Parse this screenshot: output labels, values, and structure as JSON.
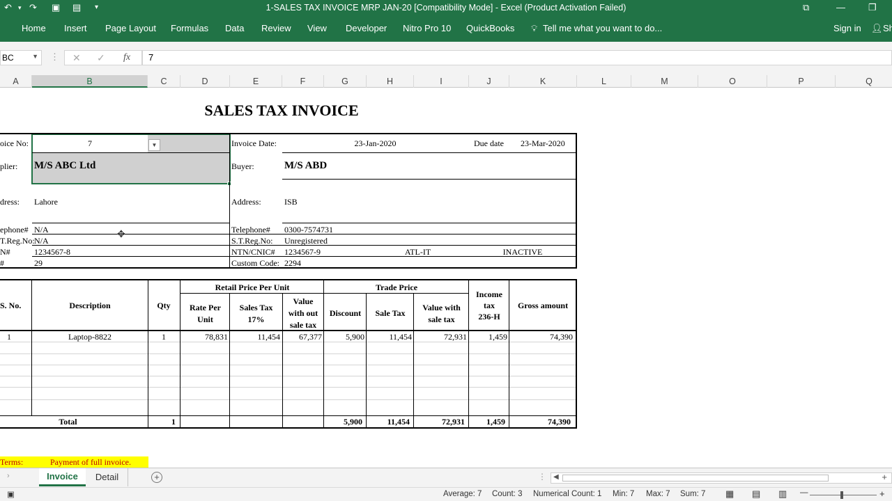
{
  "window": {
    "title": "1-SALES TAX INVOICE MRP JAN-20  [Compatibility Mode] - Excel (Product Activation Failed)"
  },
  "ribbon": {
    "tabs": [
      "Home",
      "Insert",
      "Page Layout",
      "Formulas",
      "Data",
      "Review",
      "View",
      "Developer",
      "Nitro Pro 10",
      "QuickBooks"
    ],
    "tell_me": "Tell me what you want to do...",
    "sign_in": "Sign in",
    "share": "Sh"
  },
  "formula_bar": {
    "name_box": "BC",
    "fx": "fx",
    "value": "7"
  },
  "columns": [
    "A",
    "B",
    "C",
    "D",
    "E",
    "F",
    "G",
    "H",
    "I",
    "J",
    "K",
    "L",
    "M",
    "O",
    "P",
    "Q"
  ],
  "invoice": {
    "heading": "SALES TAX INVOICE",
    "invoice_no_label": "oice No:",
    "invoice_no": "7",
    "invoice_date_label": "Invoice Date:",
    "invoice_date": "23-Jan-2020",
    "due_date_label": "Due date",
    "due_date": "23-Mar-2020",
    "supplier_label": "plier:",
    "supplier": "M/S ABC Ltd",
    "buyer_label": "Buyer:",
    "buyer": "M/S ABD",
    "address_label": "dress:",
    "address": "Lahore",
    "buyer_address_label": "Address:",
    "buyer_address": "ISB",
    "tel_label": "ephone#",
    "tel": "N/A",
    "buyer_tel_label": "Telephone#",
    "buyer_tel": "0300-7574731",
    "streg_label": "T.Reg.No:",
    "streg": "N/A",
    "buyer_streg_label": "S.T.Reg.No:",
    "buyer_streg": "Unregistered",
    "ntn_label": "N#",
    "ntn": "1234567-8",
    "buyer_ntn_label": "NTN/CNIC#",
    "buyer_ntn": "1234567-9",
    "atl": "ATL-IT",
    "status": "INACTIVE",
    "code_label": "#",
    "code": "29",
    "buyer_code_label": "Custom Code:",
    "buyer_code": "2294"
  },
  "table": {
    "h_sno": "S. No.",
    "h_desc": "Description",
    "h_qty": "Qty",
    "h_retail": "Retail Price Per Unit",
    "h_trade": "Trade Price",
    "h_rate1": "Rate Per",
    "h_rate2": "Unit",
    "h_stax1": "Sales Tax",
    "h_stax2": "17%",
    "h_vwo1": "Value",
    "h_vwo2": "with out",
    "h_vwo3": "sale tax",
    "h_disc": "Discount",
    "h_saletax": "Sale Tax",
    "h_vw1": "Value with",
    "h_vw2": "sale tax",
    "h_inc1": "Income",
    "h_inc2": "tax",
    "h_inc3": "236-H",
    "h_gross": "Gross amount",
    "row": {
      "sno": "1",
      "desc": "Laptop-8822",
      "qty": "1",
      "rate": "78,831",
      "stax": "11,454",
      "vwo": "67,377",
      "disc": "5,900",
      "saletax": "11,454",
      "vw": "72,931",
      "inc": "1,459",
      "gross": "74,390"
    },
    "total": {
      "label": "Total",
      "qty": "1",
      "disc": "5,900",
      "saletax": "11,454",
      "vw": "72,931",
      "inc": "1,459",
      "gross": "74,390"
    }
  },
  "terms": {
    "label": "Terms:",
    "value": "Payment of full invoice."
  },
  "sheets": [
    "Invoice",
    "Detail"
  ],
  "active_sheet": "Invoice",
  "status": {
    "average": "Average: 7",
    "count": "Count: 3",
    "numerical_count": "Numerical Count: 1",
    "min": "Min: 7",
    "max": "Max: 7",
    "sum": "Sum: 7"
  },
  "colors": {
    "excel_green": "#217346",
    "selection_fill": "#d0d0d0",
    "terms_highlight": "#ffff00",
    "terms_text": "#c00000"
  }
}
